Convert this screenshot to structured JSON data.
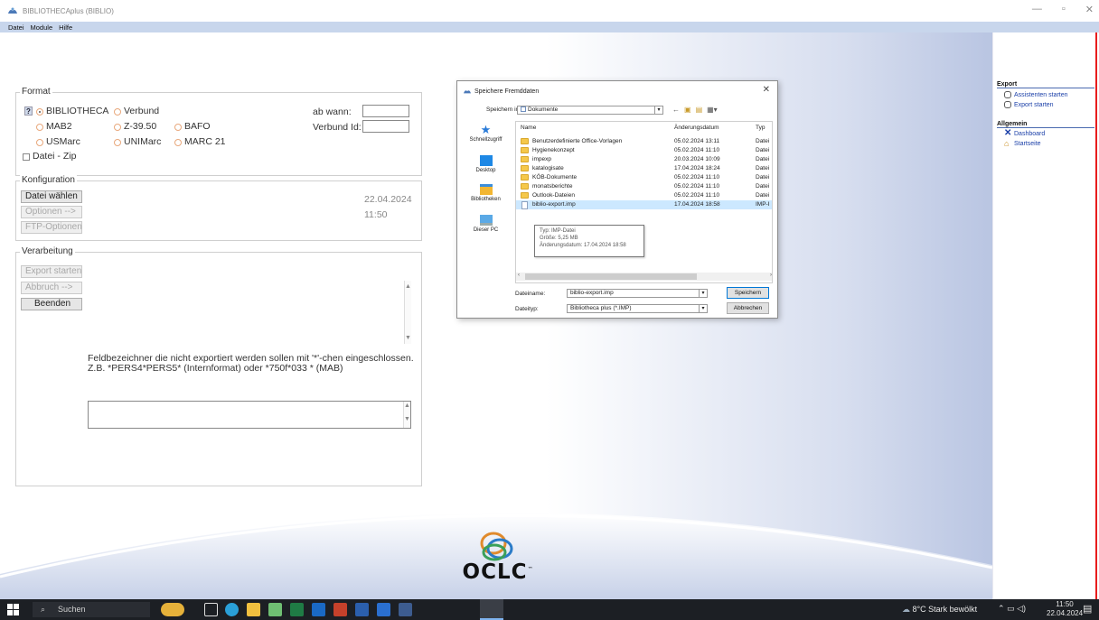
{
  "window": {
    "title": "BIBLIOTHECAplus (BIBLIO)",
    "minimize": "—",
    "maximize": "▫",
    "close": "✕"
  },
  "menu": [
    "Datei",
    "Module",
    "Hilfe"
  ],
  "format": {
    "group_title": "Format",
    "help": "?",
    "options": [
      "BIBLIOTHECA",
      "Verbund",
      "MAB2",
      "Z-39.50",
      "BAFO",
      "USMarc",
      "UNIMarc",
      "MARC 21"
    ],
    "selected": "BIBLIOTHECA",
    "zip_label": "Datei - Zip",
    "ab_wann_label": "ab wann:",
    "verbund_id_label": "Verbund Id:",
    "ab_wann_value": "",
    "verbund_id_value": ""
  },
  "konfiguration": {
    "group_title": "Konfiguration",
    "datei_waehlen": "Datei wählen",
    "optionen": "Optionen -->",
    "ftp_optionen": "FTP-Optionen",
    "date": "22.04.2024",
    "time": "11:50"
  },
  "verarbeitung": {
    "group_title": "Verarbeitung",
    "export_starten": "Export starten",
    "abbruch": "Abbruch   -->",
    "beenden": "Beenden",
    "hint_line1": "Feldbezeichner die nicht exportiert werden sollen mit '*'-chen eingeschlossen.",
    "hint_line2": "Z.B. *PERS4*PERS5* (Internformat) oder *750f*033 * (MAB)",
    "field_value": ""
  },
  "dialog": {
    "title": "Speichere Fremddaten",
    "close": "✕",
    "speichern_in_label": "Speichern in:",
    "speichern_in_value": "Dokumente",
    "places": [
      "Schnellzugriff",
      "Desktop",
      "Bibliotheken",
      "Dieser PC"
    ],
    "columns": [
      "Name",
      "Änderungsdatum",
      "Typ"
    ],
    "files": [
      {
        "name": "Benutzerdefinierte Office-Vorlagen",
        "date": "05.02.2024 13:11",
        "type": "Datei",
        "kind": "folder"
      },
      {
        "name": "Hygienekonzept",
        "date": "05.02.2024 11:10",
        "type": "Datei",
        "kind": "folder"
      },
      {
        "name": "impexp",
        "date": "20.03.2024 10:09",
        "type": "Datei",
        "kind": "folder"
      },
      {
        "name": "katalogisate",
        "date": "17.04.2024 18:24",
        "type": "Datei",
        "kind": "folder"
      },
      {
        "name": "KÖB-Dokumente",
        "date": "05.02.2024 11:10",
        "type": "Datei",
        "kind": "folder"
      },
      {
        "name": "monatsberichte",
        "date": "05.02.2024 11:10",
        "type": "Datei",
        "kind": "folder"
      },
      {
        "name": "Outlook-Dateien",
        "date": "05.02.2024 11:10",
        "type": "Datei",
        "kind": "folder"
      },
      {
        "name": "biblio-export.imp",
        "date": "17.04.2024 18:58",
        "type": "IMP-I",
        "kind": "file"
      }
    ],
    "tooltip": {
      "line1": "Typ: IMP-Datei",
      "line2": "Größe: 5,25 MB",
      "line3": "Änderungsdatum: 17.04.2024 18:58"
    },
    "dateiname_label": "Dateiname:",
    "dateiname_value": "biblio-export.imp",
    "dateityp_label": "Dateityp:",
    "dateityp_value": "Bibliotheca plus (*.IMP)",
    "save_button": "Speichern",
    "cancel_button": "Abbrechen"
  },
  "right_panel": {
    "export_heading": "Export",
    "export_links": [
      "Assistenten starten",
      "Export starten"
    ],
    "allgemein_heading": "Allgemein",
    "allgemein_links": [
      "Dashboard",
      "Startseite"
    ]
  },
  "logo": {
    "text": "OCLC",
    "tm": "™"
  },
  "taskbar": {
    "search_placeholder": "Suchen",
    "weather": "8°C  Stark bewölkt",
    "time": "11:50",
    "date": "22.04.2024"
  },
  "colors": {
    "menubar": "#c8d6ec",
    "accent_red": "#e81c1c",
    "link_blue": "#1a3fa8",
    "taskbar": "#1c1f24"
  }
}
